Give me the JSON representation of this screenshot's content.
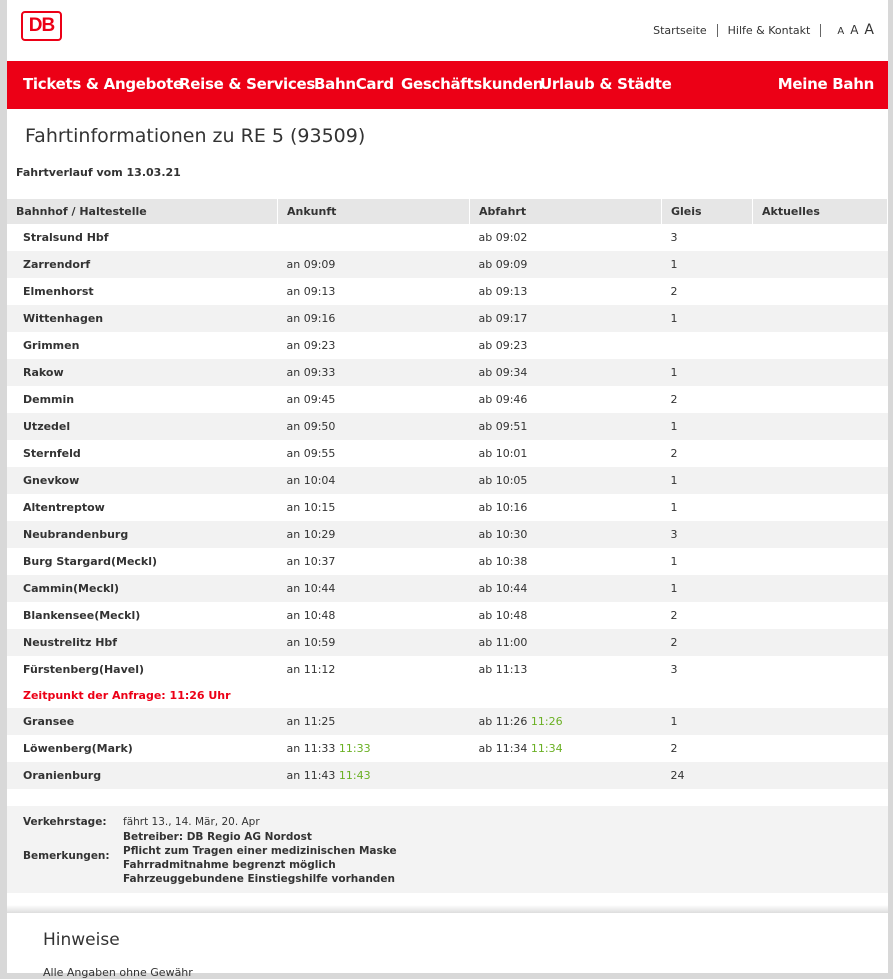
{
  "header": {
    "logo": "DB",
    "links": [
      "Startseite",
      "Hilfe & Kontakt"
    ],
    "font_sizes": [
      "A",
      "A",
      "A"
    ]
  },
  "nav": {
    "items": [
      "Tickets & Angebote",
      "Reise & Services",
      "BahnCard",
      "Geschäftskunden",
      "Urlaub & Städte"
    ],
    "account": "Meine Bahn"
  },
  "colors": {
    "brand": "#ec0016",
    "realtime": "#6ab023"
  },
  "title": "Fahrtinformationen zu RE 5 (93509)",
  "subtitle": "Fahrtverlauf vom 13.03.21",
  "table": {
    "headers": [
      "Bahnhof / Haltestelle",
      "Ankunft",
      "Abfahrt",
      "Gleis",
      "Aktuelles"
    ],
    "rows": [
      [
        "Stralsund Hbf",
        "",
        "ab 09:02",
        "3"
      ],
      [
        "Zarrendorf",
        "an 09:09",
        "ab 09:09",
        "1"
      ],
      [
        "Elmenhorst",
        "an 09:13",
        "ab 09:13",
        "2"
      ],
      [
        "Wittenhagen",
        "an 09:16",
        "ab 09:17",
        "1"
      ],
      [
        "Grimmen",
        "an 09:23",
        "ab 09:23",
        ""
      ],
      [
        "Rakow",
        "an 09:33",
        "ab 09:34",
        "1"
      ],
      [
        "Demmin",
        "an 09:45",
        "ab 09:46",
        "2"
      ],
      [
        "Utzedel",
        "an 09:50",
        "ab 09:51",
        "1"
      ],
      [
        "Sternfeld",
        "an 09:55",
        "ab 10:01",
        "2"
      ],
      [
        "Gnevkow",
        "an 10:04",
        "ab 10:05",
        "1"
      ],
      [
        "Altentreptow",
        "an 10:15",
        "ab 10:16",
        "1"
      ],
      [
        "Neubrandenburg",
        "an 10:29",
        "ab 10:30",
        "3"
      ],
      [
        "Burg Stargard(Meckl)",
        "an 10:37",
        "ab 10:38",
        "1"
      ],
      [
        "Cammin(Meckl)",
        "an 10:44",
        "ab 10:44",
        "1"
      ],
      [
        "Blankensee(Meckl)",
        "an 10:48",
        "ab 10:48",
        "2"
      ],
      [
        "Neustrelitz Hbf",
        "an 10:59",
        "ab 11:00",
        "2"
      ],
      [
        "Fürstenberg(Havel)",
        "an 11:12",
        "ab 11:13",
        "3"
      ]
    ],
    "request_time": "Zeitpunkt der Anfrage: 11:26 Uhr",
    "rows_after": [
      {
        "station": "Gransee",
        "arr": "an 11:25",
        "arr_rt": "",
        "dep": "ab 11:26",
        "dep_rt": "11:26",
        "track": "1"
      },
      {
        "station": "Löwenberg(Mark)",
        "arr": "an 11:33",
        "arr_rt": "11:33",
        "dep": "ab 11:34",
        "dep_rt": "11:34",
        "track": "2"
      },
      {
        "station": "Oranienburg",
        "arr": "an 11:43",
        "arr_rt": "11:43",
        "dep": "",
        "dep_rt": "",
        "track": "24"
      }
    ]
  },
  "info": {
    "verkehrstage_label": "Verkehrstage:",
    "verkehrstage": "fährt 13., 14. Mär, 20. Apr",
    "bemerkungen_label": "Bemerkungen:",
    "bemerkungen": [
      "Betreiber: DB Regio AG Nordost",
      "Pflicht zum Tragen einer medizinischen Maske",
      "Fahrradmitnahme begrenzt möglich",
      "Fahrzeuggebundene Einstiegshilfe vorhanden"
    ]
  },
  "hinweise": {
    "title": "Hinweise",
    "text": "Alle Angaben ohne Gewähr"
  }
}
